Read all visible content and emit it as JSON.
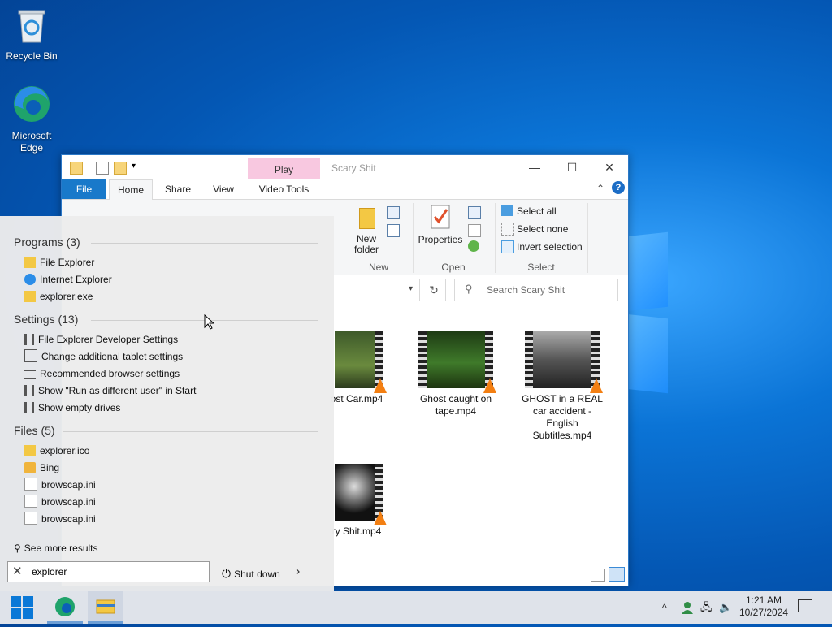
{
  "desktop": {
    "icons": [
      {
        "label": "Recycle Bin"
      },
      {
        "label": "Microsoft Edge"
      }
    ]
  },
  "explorer": {
    "title": "Scary Shit",
    "context_tab": "Play",
    "tabs": [
      "File",
      "Home",
      "Share",
      "View",
      "Video Tools"
    ],
    "ribbon": {
      "new_folder": "New folder",
      "new_group": "New",
      "properties": "Properties",
      "open_group": "Open",
      "select_all": "Select all",
      "select_none": "Select none",
      "invert_selection": "Invert selection",
      "select_group": "Select"
    },
    "search_placeholder": "Search Scary Shit",
    "files": [
      {
        "name": "ost Car.mp4"
      },
      {
        "name": "Ghost caught on tape.mp4"
      },
      {
        "name": "GHOST in a REAL car accident - English Subtitles.mp4"
      },
      {
        "name": "ry Shit.mp4"
      }
    ]
  },
  "search_panel": {
    "sections": [
      {
        "title": "Programs (3)",
        "items": [
          "File Explorer",
          "Internet Explorer",
          "explorer.exe"
        ]
      },
      {
        "title": "Settings (13)",
        "items": [
          "File Explorer Developer Settings",
          "Change additional tablet settings",
          "Recommended browser settings",
          "Show \"Run as different user\" in Start",
          "Show empty drives"
        ]
      },
      {
        "title": "Files (5)",
        "items": [
          "explorer.ico",
          "Bing",
          "browscap.ini",
          "browscap.ini",
          "browscap.ini"
        ]
      }
    ],
    "see_more": "See more results",
    "query": "explorer",
    "shut_down": "Shut down"
  },
  "taskbar": {
    "time": "1:21 AM",
    "date": "10/27/2024"
  }
}
